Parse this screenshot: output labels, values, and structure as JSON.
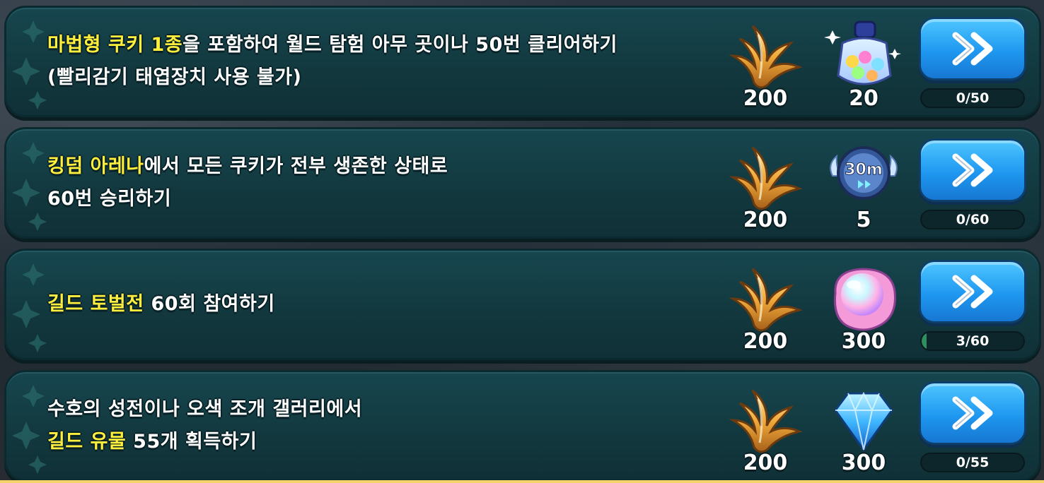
{
  "quests": [
    {
      "lines": [
        [
          {
            "text": "마법형 쿠키 1종",
            "hl": true
          },
          {
            "text": "을 포함하여 월드 탐험 아무 곳이나 50번 클리어하기",
            "hl": false
          }
        ],
        [
          {
            "text": "(빨리감기 태엽장치 사용 불가)",
            "hl": false
          }
        ]
      ],
      "reward1": {
        "icon": "golden-leaf-icon",
        "amount": "200"
      },
      "reward2": {
        "icon": "star-jar-icon",
        "amount": "20"
      },
      "progress": {
        "label": "0/50",
        "current": 0,
        "total": 50
      }
    },
    {
      "lines": [
        [
          {
            "text": "킹덤 아레나",
            "hl": true
          },
          {
            "text": "에서 모든 쿠키가 전부 생존한 상태로",
            "hl": false
          }
        ],
        [
          {
            "text": "60번 승리하기",
            "hl": false
          }
        ]
      ],
      "reward1": {
        "icon": "golden-leaf-icon",
        "amount": "200"
      },
      "reward2": {
        "icon": "speed-up-30m-icon",
        "amount": "5",
        "badge": "30m"
      },
      "progress": {
        "label": "0/60",
        "current": 0,
        "total": 60
      }
    },
    {
      "lines": [
        [
          {
            "text": "길드 토벌전",
            "hl": true
          },
          {
            "text": " 60회 참여하기",
            "hl": false
          }
        ]
      ],
      "reward1": {
        "icon": "golden-leaf-icon",
        "amount": "200"
      },
      "reward2": {
        "icon": "rainbow-cube-icon",
        "amount": "300"
      },
      "progress": {
        "label": "3/60",
        "current": 3,
        "total": 60
      }
    },
    {
      "lines": [
        [
          {
            "text": "수호의 성전이나 오색 조개 갤러리에서",
            "hl": false
          }
        ],
        [
          {
            "text": "길드 유물",
            "hl": true
          },
          {
            "text": " 55개 획득하기",
            "hl": false
          }
        ]
      ],
      "reward1": {
        "icon": "golden-leaf-icon",
        "amount": "200"
      },
      "reward2": {
        "icon": "crystal-icon",
        "amount": "300"
      },
      "progress": {
        "label": "0/55",
        "current": 0,
        "total": 55
      }
    }
  ],
  "colors": {
    "highlight": "#ffee3c",
    "card": "#14404a",
    "button": "#2aa6f5"
  }
}
